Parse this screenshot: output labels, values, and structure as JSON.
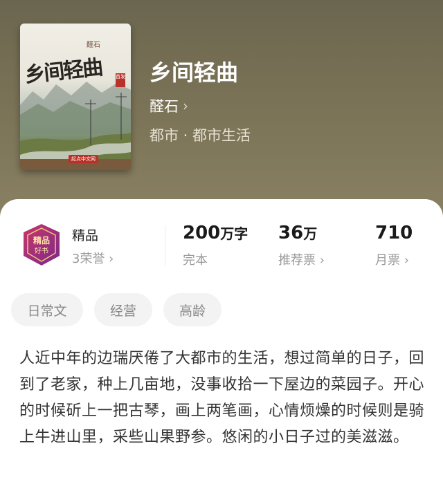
{
  "book": {
    "cover_title": "乡间轻曲",
    "cover_author": "醛石",
    "cover_seal": "首发",
    "cover_publisher": "起点中文网",
    "title": "乡间轻曲",
    "author": "醛石",
    "author_chevron": "›",
    "genre": "都市 · 都市生活"
  },
  "stats": {
    "badge_label": "精品",
    "honor": "3荣誉 ›",
    "words_num": "200",
    "words_unit": "万字",
    "status": "完本",
    "rec_num": "36",
    "rec_unit": "万",
    "rec_label": "推荐票 ›",
    "monthly_num": "710",
    "monthly_label": "月票 ›"
  },
  "tags": [
    "日常文",
    "经营",
    "高龄"
  ],
  "description": "人近中年的边瑞厌倦了大都市的生活，想过简单的日子，回到了老家，种上几亩地，没事收拾一下屋边的菜园子。开心的时候斫上一把古琴，画上两笔画，心情烦燥的时候则是骑上牛进山里，采些山果野参。悠闲的小日子过的美滋滋。"
}
